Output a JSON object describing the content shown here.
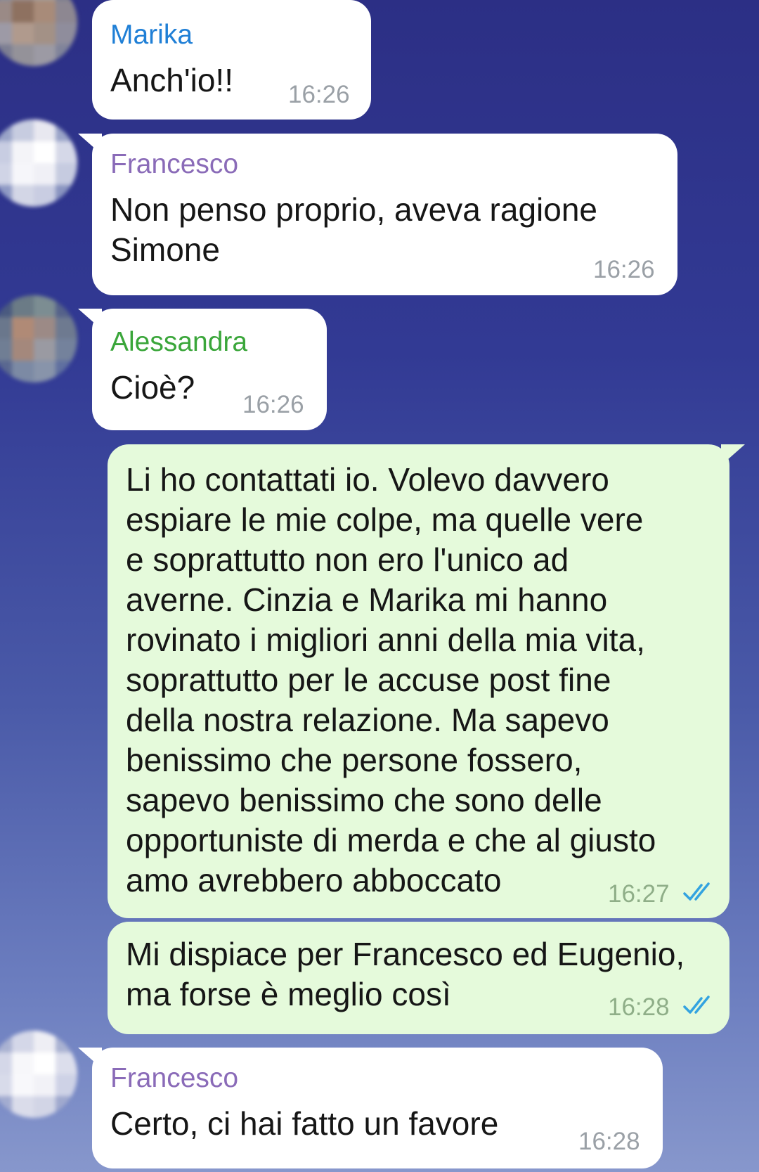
{
  "colors": {
    "marika": "#1f7fd6",
    "francesco": "#8a6bb8",
    "alessandra": "#3aa63a",
    "read_ticks": "#33a3e0"
  },
  "messages": [
    {
      "sender": "Marika",
      "text": "Anch'io!!",
      "time": "16:26",
      "direction": "incoming"
    },
    {
      "sender": "Francesco",
      "text": "Non penso proprio, aveva ragione\nSimone",
      "time": "16:26",
      "direction": "incoming"
    },
    {
      "sender": "Alessandra",
      "text": "Cioè?",
      "time": "16:26",
      "direction": "incoming"
    },
    {
      "text": "Li ho contattati io. Volevo davvero\nespiare le mie colpe, ma quelle vere\ne soprattutto non ero l'unico ad\naverne. Cinzia e Marika mi hanno\nrovinato i migliori anni della mia vita,\nsoprattutto per le accuse post fine\ndella nostra relazione. Ma sapevo\nbenissimo che persone fossero,\nsapevo benissimo che sono delle\nopportuniste di merda e che al giusto\namo avrebbero abboccato",
      "time": "16:27",
      "direction": "outgoing",
      "status": "read"
    },
    {
      "text": "Mi dispiace per Francesco ed Eugenio,\nma forse è meglio così",
      "time": "16:28",
      "direction": "outgoing",
      "status": "read"
    },
    {
      "sender": "Francesco",
      "text": "Certo, ci hai fatto un favore",
      "time": "16:28",
      "direction": "incoming"
    }
  ],
  "icons": {
    "avatar": "blurred-avatar-icon",
    "read_receipt": "double-check-icon"
  }
}
